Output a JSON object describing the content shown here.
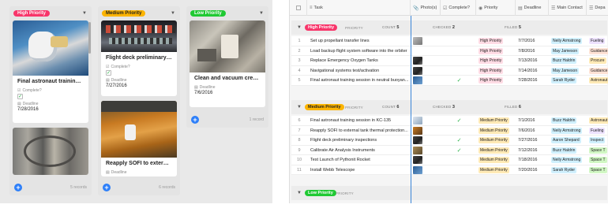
{
  "board": {
    "columns": [
      {
        "tag": "High Priority",
        "color": "#f8356a",
        "text_color": "#fff",
        "count": "",
        "cards": [
          {
            "title": "Final astronaut training s...",
            "complete_label": "Complete?",
            "complete": true,
            "deadline_label": "Deadline",
            "deadline": "7/28/2016",
            "image": "astronaut"
          },
          {
            "title": "",
            "image": "rocket-engine"
          }
        ],
        "footer_count": "5 records"
      },
      {
        "tag": "Medium Priority",
        "color": "#fcb400",
        "text_color": "#222",
        "cards": [
          {
            "title": "Flight deck preliminary in...",
            "complete_label": "Complete?",
            "complete": true,
            "deadline_label": "Deadline",
            "deadline": "7/27/2016",
            "image": "cockpit"
          },
          {
            "title": "Reapply SOFI to external ...",
            "deadline_label": "Deadline",
            "image": "tank"
          }
        ],
        "footer_count": "6 records"
      },
      {
        "tag": "Low Priority",
        "color": "#20c933",
        "text_color": "#fff",
        "cards": [
          {
            "title": "Clean and vacuum crew ...",
            "deadline_label": "Deadline",
            "deadline": "7/6/2016",
            "image": "crew-room"
          }
        ],
        "footer_count": "1 record"
      }
    ]
  },
  "grid": {
    "headers": [
      "Task",
      "Photo(s)",
      "Complete?",
      "Priority",
      "Deadline",
      "Main Contact",
      "Depa"
    ],
    "groups": [
      {
        "label": "High Priority",
        "color": "#f8356a",
        "text_color": "#fff",
        "field": "PRIORITY",
        "count_label": "COUNT",
        "count": "5",
        "checked_label": "CHECKED",
        "checked": "2",
        "filled_label": "FILLED",
        "filled": "5",
        "rows": [
          {
            "n": "1",
            "task": "Set up propellant transfer lines",
            "photo": "grey",
            "complete": false,
            "priority": "High Priority",
            "deadline": "7/7/2016",
            "contact": "Neily Armstrong",
            "dept": "Fueling"
          },
          {
            "n": "2",
            "task": "Load backup flight system software into the orbiter",
            "photo": "",
            "complete": false,
            "priority": "High Priority",
            "deadline": "7/8/2016",
            "contact": "May Jameson",
            "dept": "Guidance"
          },
          {
            "n": "3",
            "task": "Replace Emergency Oxygen Tanks",
            "photo": "dark",
            "complete": false,
            "priority": "High Priority",
            "deadline": "7/13/2016",
            "contact": "Buzz Haldrin",
            "dept": "Procure"
          },
          {
            "n": "4",
            "task": "Navigational systems test/activation",
            "photo": "dark",
            "complete": false,
            "priority": "High Priority",
            "deadline": "7/14/2016",
            "contact": "May Jameson",
            "dept": "Guidance"
          },
          {
            "n": "5",
            "task": "Final astronaut training session in neutral buoyan...",
            "photo": "blue",
            "complete": true,
            "priority": "High Priority",
            "deadline": "7/28/2016",
            "contact": "Sarah Ryder",
            "dept": "Astronaut"
          }
        ]
      },
      {
        "label": "Medium Priority",
        "color": "#fcb400",
        "text_color": "#222",
        "field": "PRIORITY",
        "count_label": "COUNT",
        "count": "6",
        "checked_label": "CHECKED",
        "checked": "3",
        "filled_label": "FILLED",
        "filled": "6",
        "rows": [
          {
            "n": "6",
            "task": "Final astronaut training session in KC-135",
            "photo": "plane",
            "complete": true,
            "priority": "Medium Priority",
            "deadline": "7/1/2016",
            "contact": "Buzz Haldrin",
            "dept": "Astronaut"
          },
          {
            "n": "7",
            "task": "Reapply SOFI to external tank thermal protection...",
            "photo": "orange",
            "complete": false,
            "priority": "Medium Priority",
            "deadline": "7/6/2016",
            "contact": "Neily Armstrong",
            "dept": "Fueling"
          },
          {
            "n": "8",
            "task": "Flight deck preliminary inspections",
            "photo": "dark",
            "complete": true,
            "priority": "Medium Priority",
            "deadline": "7/27/2016",
            "contact": "Aaron Shepard",
            "dept": "Inspect"
          },
          {
            "n": "9",
            "task": "Calibrate Air Analysis Instruments",
            "photo": "brown",
            "complete": true,
            "priority": "Medium Priority",
            "deadline": "7/12/2016",
            "contact": "Buzz Haldrin",
            "dept": "Space T"
          },
          {
            "n": "10",
            "task": "Test Launch of Pythonit Rocket",
            "photo": "dark",
            "complete": false,
            "priority": "Medium Priority",
            "deadline": "7/18/2016",
            "contact": "Neily Armstrong",
            "dept": "Space T"
          },
          {
            "n": "11",
            "task": "Install Webb Telescope",
            "photo": "blue",
            "complete": false,
            "priority": "Medium Priority",
            "deadline": "7/20/2016",
            "contact": "Sarah Ryder",
            "dept": "Space T"
          }
        ]
      },
      {
        "label": "Low Priority",
        "color": "#20c933",
        "text_color": "#fff",
        "field": "PRIORITY",
        "rows": []
      }
    ],
    "pill_colors": {
      "High Priority": "#ffdce5",
      "Medium Priority": "#ffeab6",
      "contact": "#d0f0fd",
      "Fueling": "#ede2fe",
      "Guidance": "#fee2d5",
      "Procure": "#ffeab6",
      "Astronaut": "#ffeab6",
      "Inspect": "#d0f0fd",
      "Space T": "#d1f7c4"
    }
  }
}
